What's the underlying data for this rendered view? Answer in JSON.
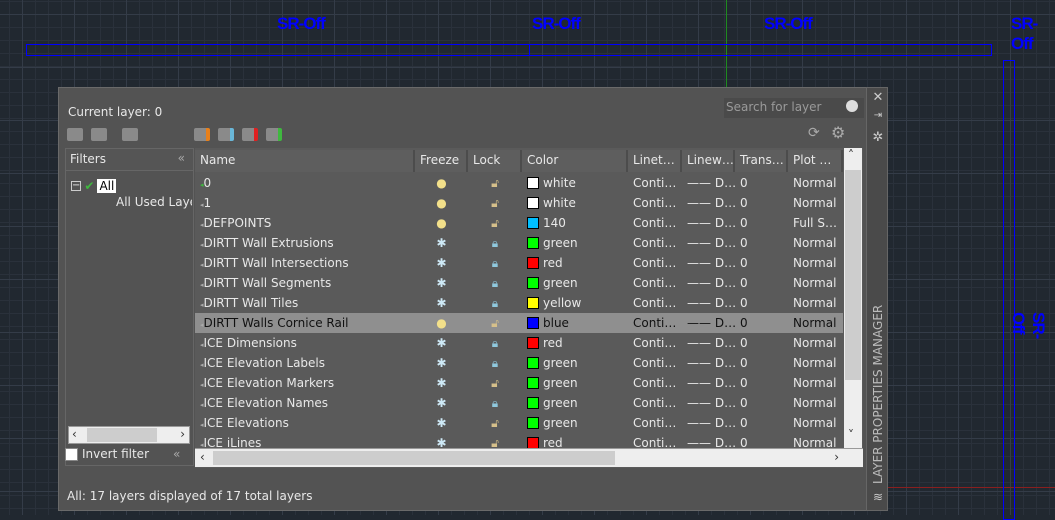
{
  "canvas": {
    "labels": [
      "SR-Off",
      "SR-Off",
      "SR-Off",
      "SR-Off",
      "SR-Off"
    ],
    "ink_color": "#0000ff"
  },
  "palette": {
    "title": "LAYER PROPERTIES MANAGER",
    "current_layer": "Current layer: 0",
    "search_placeholder": "Search for layer",
    "filters": {
      "header": "Filters",
      "tree": [
        "All",
        "All Used Layers"
      ],
      "invert_filter": "Invert filter"
    },
    "columns": [
      "Name",
      "Freeze",
      "Lock",
      "Color",
      "Linet…",
      "Linew…",
      "Trans…",
      "Plot …"
    ],
    "layers": [
      {
        "name": "0",
        "freeze": "on",
        "lock": "unlocked",
        "color": "white",
        "hex": "#ffffff",
        "linetype": "Conti…",
        "lineweight": "D…",
        "trans": "0",
        "plot": "Normal",
        "current": true
      },
      {
        "name": "1",
        "freeze": "on",
        "lock": "unlocked",
        "color": "white",
        "hex": "#ffffff",
        "linetype": "Conti…",
        "lineweight": "D…",
        "trans": "0",
        "plot": "Normal"
      },
      {
        "name": "DEFPOINTS",
        "freeze": "on",
        "lock": "unlocked",
        "color": "140",
        "hex": "#00bfff",
        "linetype": "Conti…",
        "lineweight": "D…",
        "trans": "0",
        "plot": "Full S…"
      },
      {
        "name": "DIRTT Wall Extrusions",
        "freeze": "frozen",
        "lock": "locked",
        "color": "green",
        "hex": "#00ff00",
        "linetype": "Conti…",
        "lineweight": "D…",
        "trans": "0",
        "plot": "Normal"
      },
      {
        "name": "DIRTT Wall Intersections",
        "freeze": "frozen",
        "lock": "locked",
        "color": "red",
        "hex": "#ff0000",
        "linetype": "Conti…",
        "lineweight": "D…",
        "trans": "0",
        "plot": "Normal"
      },
      {
        "name": "DIRTT Wall Segments",
        "freeze": "frozen",
        "lock": "locked",
        "color": "green",
        "hex": "#00ff00",
        "linetype": "Conti…",
        "lineweight": "D…",
        "trans": "0",
        "plot": "Normal"
      },
      {
        "name": "DIRTT Wall Tiles",
        "freeze": "frozen",
        "lock": "locked",
        "color": "yellow",
        "hex": "#ffff00",
        "linetype": "Conti…",
        "lineweight": "D…",
        "trans": "0",
        "plot": "Normal"
      },
      {
        "name": "DIRTT Walls Cornice Rail",
        "freeze": "on",
        "lock": "unlocked",
        "color": "blue",
        "hex": "#0000ff",
        "linetype": "Conti…",
        "lineweight": "D…",
        "trans": "0",
        "plot": "Normal",
        "selected": true
      },
      {
        "name": "ICE Dimensions",
        "freeze": "frozen",
        "lock": "locked",
        "color": "red",
        "hex": "#ff0000",
        "linetype": "Conti…",
        "lineweight": "D…",
        "trans": "0",
        "plot": "Normal"
      },
      {
        "name": "ICE Elevation Labels",
        "freeze": "frozen",
        "lock": "locked",
        "color": "green",
        "hex": "#00ff00",
        "linetype": "Conti…",
        "lineweight": "D…",
        "trans": "0",
        "plot": "Normal"
      },
      {
        "name": "ICE Elevation Markers",
        "freeze": "frozen",
        "lock": "unlocked",
        "color": "green",
        "hex": "#00ff00",
        "linetype": "Conti…",
        "lineweight": "D…",
        "trans": "0",
        "plot": "Normal"
      },
      {
        "name": "ICE Elevation Names",
        "freeze": "frozen",
        "lock": "locked",
        "color": "green",
        "hex": "#00ff00",
        "linetype": "Conti…",
        "lineweight": "D…",
        "trans": "0",
        "plot": "Normal"
      },
      {
        "name": "ICE Elevations",
        "freeze": "frozen",
        "lock": "unlocked",
        "color": "green",
        "hex": "#00ff00",
        "linetype": "Conti…",
        "lineweight": "D…",
        "trans": "0",
        "plot": "Normal"
      },
      {
        "name": "ICE iLines",
        "freeze": "frozen",
        "lock": "unlocked",
        "color": "red",
        "hex": "#ff0000",
        "linetype": "Conti…",
        "lineweight": "D…",
        "trans": "0",
        "plot": "Normal"
      }
    ],
    "status": "All: 17 layers displayed of 17 total layers"
  }
}
